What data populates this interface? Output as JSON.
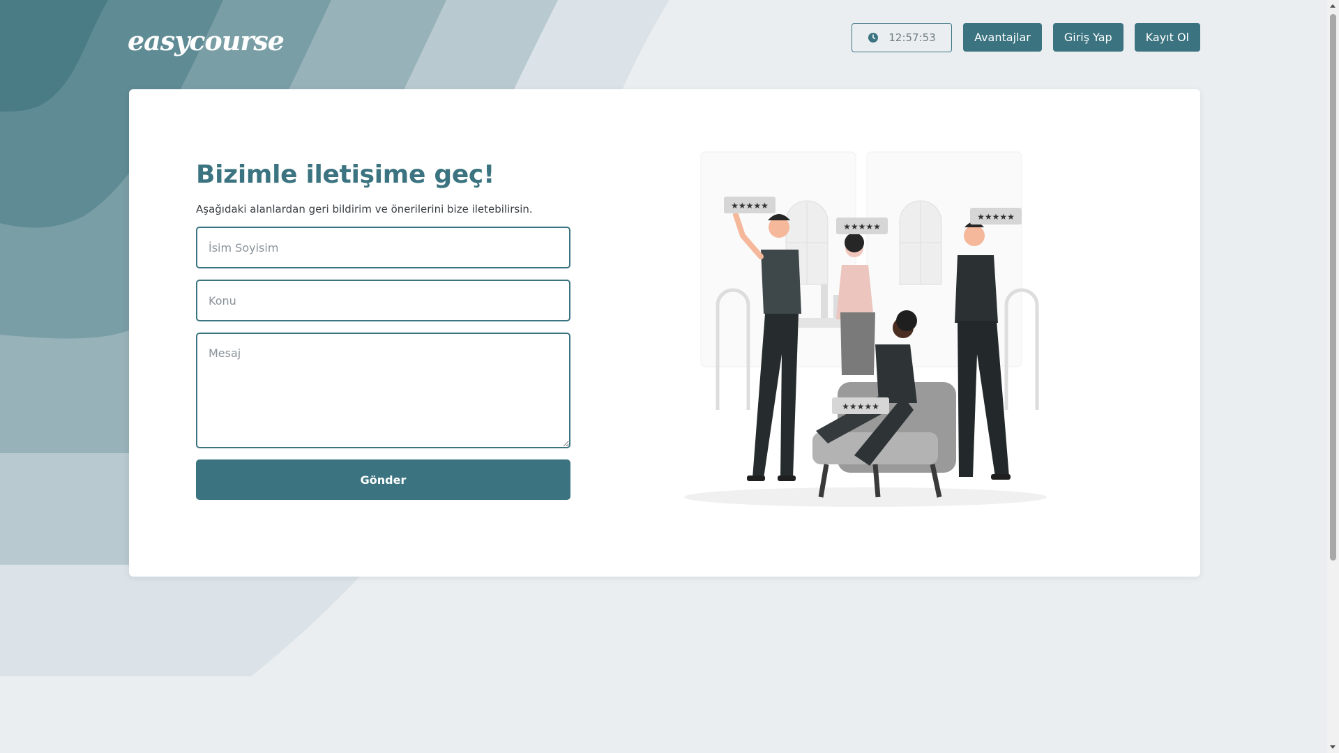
{
  "header": {
    "logo_text": "easycourse",
    "clock_time": "12:57:53",
    "nav": {
      "advantages_label": "Avantajlar",
      "login_label": "Giriş Yap",
      "register_label": "Kayıt Ol"
    }
  },
  "contact": {
    "title": "Bizimle iletişime geç!",
    "subtitle": "Aşağıdaki alanlardan geri bildirim ve önerilerini bize iletebilirsin.",
    "name_placeholder": "İsim Soyisim",
    "subject_placeholder": "Konu",
    "message_placeholder": "Mesaj",
    "submit_label": "Gönder"
  },
  "illustration": {
    "rating_badges": [
      "★★★★★",
      "★★★★★",
      "★★★★★",
      "★★★★★"
    ]
  },
  "colors": {
    "accent": "#3b7480",
    "background": "#eaeef1",
    "card": "#ffffff"
  },
  "icons": [
    "clock-icon"
  ]
}
